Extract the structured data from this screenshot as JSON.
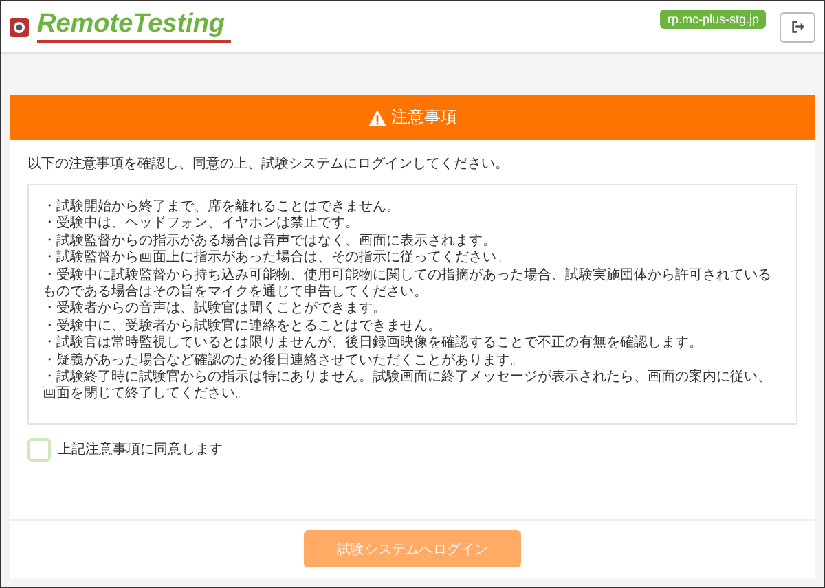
{
  "header": {
    "logo_text": "RemoteTesting",
    "host_badge": "rp.mc-plus-stg.jp"
  },
  "notice": {
    "title": "注意事項",
    "intro": "以下の注意事項を確認し、同意の上、試験システムにログインしてください。",
    "items": [
      "・試験開始から終了まで、席を離れることはできません。",
      "・受験中は、ヘッドフォン、イヤホンは禁止です。",
      "・試験監督からの指示がある場合は音声ではなく、画面に表示されます。",
      "・試験監督から画面上に指示があった場合は、その指示に従ってください。",
      "・受験中に試験監督から持ち込み可能物、使用可能物に関しての指摘があった場合、試験実施団体から許可されているものである場合はその旨をマイクを通じて申告してください。",
      "・受験者からの音声は、試験官は聞くことができます。",
      "・受験中に、受験者から試験官に連絡をとることはできません。",
      "・試験官は常時監視しているとは限りませんが、後日録画映像を確認することで不正の有無を確認します。",
      "・疑義があった場合など確認のため後日連絡させていただくことがあります。",
      "・試験終了時に試験官からの指示は特にありません。試験画面に終了メッセージが表示されたら、画面の案内に従い、画面を閉じて終了してください。"
    ],
    "agree": {
      "label": "上記注意事項に同意します",
      "checked": false
    },
    "login_button": {
      "label": "試験システムへログイン",
      "disabled": true
    }
  }
}
